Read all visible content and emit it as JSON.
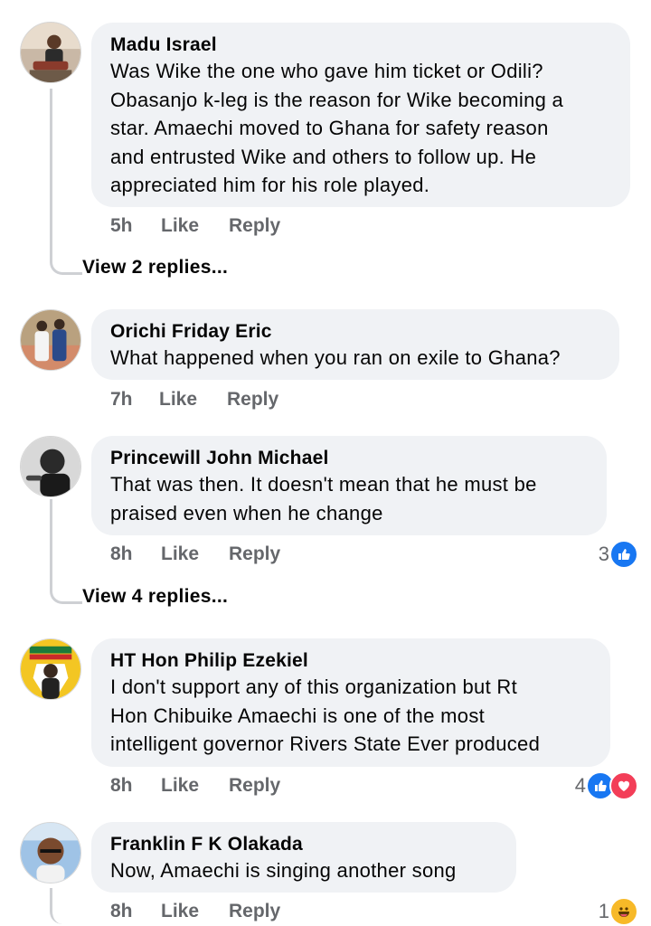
{
  "comments": [
    {
      "author": "Madu Israel",
      "lines": [
        "Was Wike the one who gave him ticket or Odili?",
        "Obasanjo k-leg is the reason for Wike becoming a",
        "star. Amaechi moved to Ghana for safety reason",
        "and entrusted Wike and others to follow up. He",
        "appreciated him for his role played."
      ],
      "time": "5h",
      "like": "Like",
      "reply": "Reply",
      "view_replies": "View 2 replies..."
    },
    {
      "author": "Orichi Friday Eric",
      "lines": [
        "What happened when you ran on exile to Ghana?"
      ],
      "time": "7h",
      "like": "Like",
      "reply": "Reply"
    },
    {
      "author": "Princewill John Michael",
      "lines": [
        "That was then. It doesn't mean that he must be",
        "praised even when he change"
      ],
      "time": "8h",
      "like": "Like",
      "reply": "Reply",
      "reaction_count": "3",
      "view_replies": "View 4 replies..."
    },
    {
      "author": "HT Hon Philip Ezekiel",
      "lines": [
        "I don't support any of this organization but Rt",
        "Hon Chibuike Amaechi is one of the most",
        "intelligent governor Rivers State Ever produced"
      ],
      "time": "8h",
      "like": "Like",
      "reply": "Reply",
      "reaction_count": "4"
    },
    {
      "author": "Franklin F K Olakada",
      "lines": [
        "Now, Amaechi is singing another song"
      ],
      "time": "8h",
      "like": "Like",
      "reply": "Reply",
      "reaction_count": "1"
    }
  ],
  "colors": {
    "bubble": "#f0f2f5",
    "meta": "#65676b",
    "like_blue": "#1877f2",
    "love_red": "#f33e58",
    "haha_yellow": "#f7b928"
  }
}
